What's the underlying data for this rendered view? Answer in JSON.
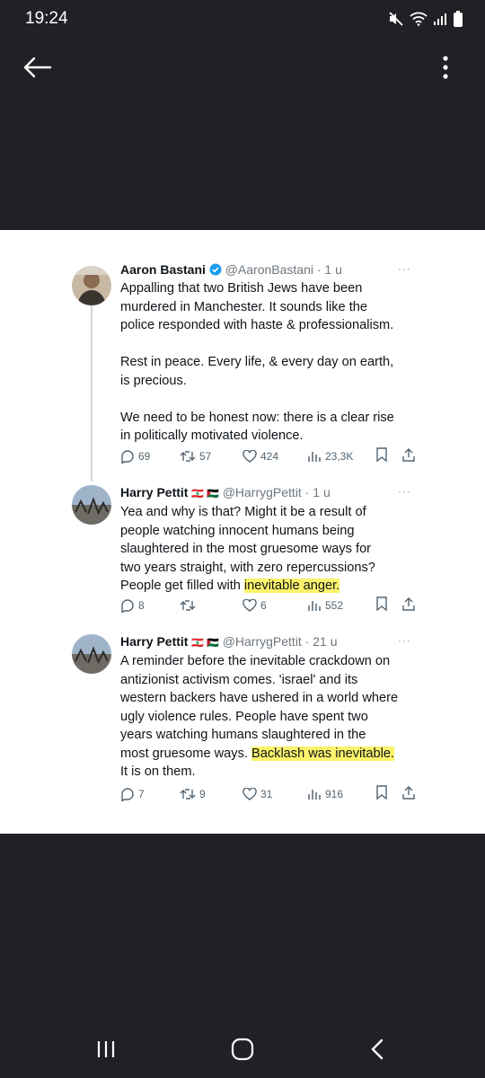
{
  "status": {
    "time": "19:24",
    "icons": [
      "mute-icon",
      "wifi-icon",
      "signal-icon",
      "battery-icon"
    ]
  },
  "top_bar": {
    "icons": [
      "back-arrow-icon",
      "more-vertical-icon"
    ]
  },
  "tweets": [
    {
      "name": "Aaron Bastani",
      "verified": true,
      "handle": "@AaronBastani · 1 u",
      "text_before": "Appalling that two British Jews have been\nmurdered in Manchester. It sounds like the\npolice responded with haste & professionalism.\n\nRest in peace. Every life, & every day on earth,\nis precious.\n\nWe need to be honest now: there is a clear rise\nin politically motivated violence.",
      "highlight": "",
      "text_after": "",
      "replies": "69",
      "retweets": "57",
      "likes": "424",
      "views": "23,3K"
    },
    {
      "name": "Harry Pettit",
      "flags": "🇱🇧 🇵🇸",
      "handle": "@HarrygPettit · 1 u",
      "text_before": "Yea and why is that? Might it be a result of\npeople watching innocent humans being\nslaughtered in the most gruesome ways for\ntwo years straight, with zero repercussions?\nPeople get filled with ",
      "highlight": "inevitable anger.",
      "text_after": "",
      "replies": "8",
      "retweets": "",
      "likes": "6",
      "views": "552"
    },
    {
      "name": "Harry Pettit",
      "flags": "🇱🇧 🇵🇸",
      "handle": "@HarrygPettit · 21 u",
      "text_before": "A reminder before the inevitable crackdown on\nantizionist activism comes. 'israel' and its\nwestern backers have ushered in a world where\nugly violence rules. People have spent two\nyears watching humans slaughtered in the\nmost gruesome ways. ",
      "highlight": "Backlash was inevitable.",
      "text_after": "\nIt is on them.",
      "replies": "7",
      "retweets": "9",
      "likes": "31",
      "views": "916"
    }
  ],
  "nav_bar": {
    "icons": [
      "recent-apps-icon",
      "home-icon",
      "back-icon"
    ]
  },
  "colors": {
    "background": "#202125",
    "panel": "#ffffff",
    "highlight": "#fbf36b",
    "verified": "#1d9bf0",
    "muted": "#536471"
  }
}
